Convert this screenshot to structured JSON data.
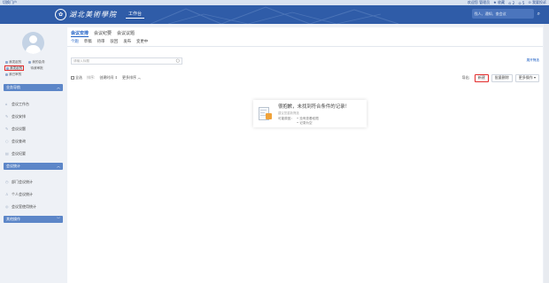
{
  "topbar": {
    "portal": "切换门户",
    "welcome": "欢迎您 管理员",
    "collect": "★ 收藏",
    "counter1": "⊙ 2",
    "counter2": "⊙ 5",
    "feedback": "⊙ 我要投诉"
  },
  "header": {
    "logo_text": "湖北美術學院",
    "nav_workbench": "工作台",
    "search_placeholder": "找人、通知、查会议"
  },
  "sidebar": {
    "quick": [
      {
        "label": "我发起的"
      },
      {
        "label": "我的会务"
      },
      {
        "label": "我发起的"
      },
      {
        "label": "待我审批"
      },
      {
        "label": "我已审的"
      }
    ],
    "sections": [
      {
        "label": "业务导航",
        "items": [
          "会议工作台",
          "会议安排",
          "会议议题",
          "会议查询",
          "会议纪要"
        ]
      },
      {
        "label": "会议统计",
        "items": [
          "部门会议统计",
          "个人会议统计",
          "会议室使用统计"
        ]
      },
      {
        "label": "其他操作",
        "items": []
      }
    ]
  },
  "main": {
    "tabs": [
      "会议安排",
      "会议纪要",
      "会议议题"
    ],
    "subtabs": [
      "个跑",
      "草稿",
      "待审",
      "驳回",
      "发布",
      "变更中"
    ],
    "filter_placeholder": "请输入标题",
    "advanced_filter": "展开筛选",
    "toolbar": {
      "select_all": "全选",
      "sort_label": "排序:",
      "sort_created": "创建时间 ⇕",
      "sort_more": "更多排序 ︿",
      "export": "导出",
      "new": "新建",
      "batch_delete": "批量删除",
      "more_actions": "更多操作 ▾"
    },
    "empty": {
      "title": "很抱歉，未找到符合条件的记录！",
      "subtitle": "建议您重新筛选",
      "reasons_label": "可能原因：",
      "reasons": [
        "没有查看权限",
        "记录为空"
      ]
    }
  }
}
